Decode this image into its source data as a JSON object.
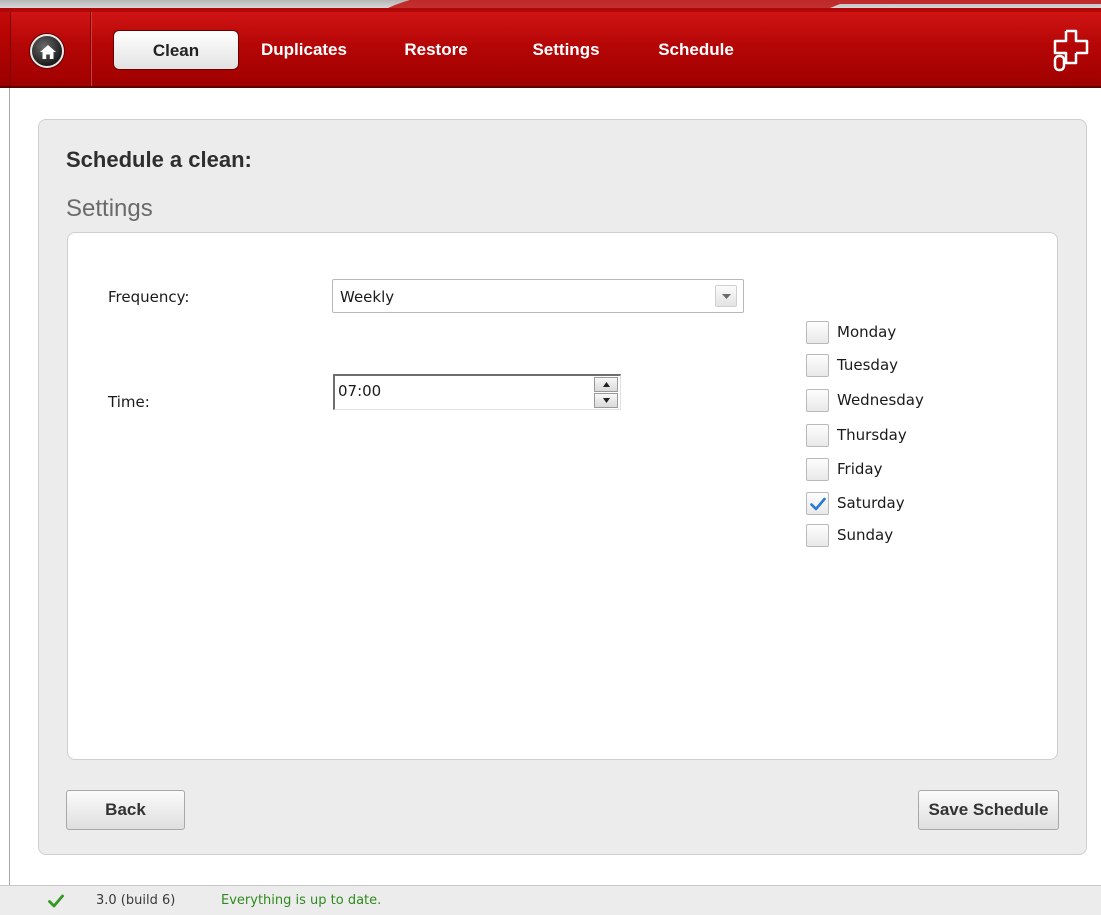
{
  "nav": {
    "tabs": [
      {
        "label": "Clean",
        "active": true
      },
      {
        "label": "Duplicates",
        "active": false
      },
      {
        "label": "Restore",
        "active": false
      },
      {
        "label": "Settings",
        "active": false
      },
      {
        "label": "Schedule",
        "active": false
      }
    ],
    "icons": {
      "home": "home-icon",
      "logo": "app-logo-icon"
    }
  },
  "panel": {
    "title": "Schedule a clean:",
    "subtitle": "Settings"
  },
  "form": {
    "frequency_label": "Frequency:",
    "frequency_value": "Weekly",
    "time_label": "Time:",
    "time_value": "07:00"
  },
  "days": [
    {
      "label": "Monday",
      "checked": false
    },
    {
      "label": "Tuesday",
      "checked": false
    },
    {
      "label": "Wednesday",
      "checked": false
    },
    {
      "label": "Thursday",
      "checked": false
    },
    {
      "label": "Friday",
      "checked": false
    },
    {
      "label": "Saturday",
      "checked": true
    },
    {
      "label": "Sunday",
      "checked": false
    }
  ],
  "buttons": {
    "back": "Back",
    "save": "Save Schedule"
  },
  "status": {
    "version": "3.0 (build 6)",
    "message": "Everything is up to date."
  },
  "colors": {
    "brand_red": "#b80404",
    "status_green": "#2e8b1e",
    "check_blue": "#2a78d6"
  }
}
